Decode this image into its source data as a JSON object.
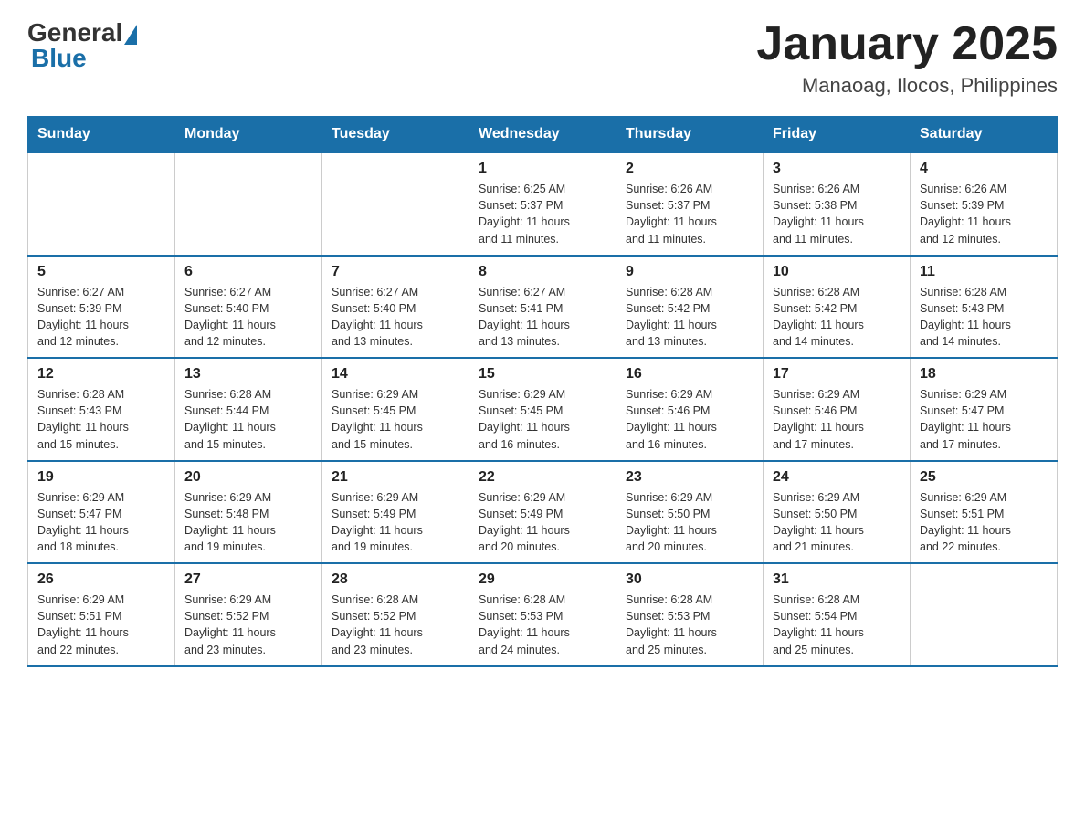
{
  "header": {
    "logo_general": "General",
    "logo_blue": "Blue",
    "title": "January 2025",
    "subtitle": "Manaoag, Ilocos, Philippines"
  },
  "days_of_week": [
    "Sunday",
    "Monday",
    "Tuesday",
    "Wednesday",
    "Thursday",
    "Friday",
    "Saturday"
  ],
  "weeks": [
    [
      {
        "day": "",
        "info": ""
      },
      {
        "day": "",
        "info": ""
      },
      {
        "day": "",
        "info": ""
      },
      {
        "day": "1",
        "info": "Sunrise: 6:25 AM\nSunset: 5:37 PM\nDaylight: 11 hours\nand 11 minutes."
      },
      {
        "day": "2",
        "info": "Sunrise: 6:26 AM\nSunset: 5:37 PM\nDaylight: 11 hours\nand 11 minutes."
      },
      {
        "day": "3",
        "info": "Sunrise: 6:26 AM\nSunset: 5:38 PM\nDaylight: 11 hours\nand 11 minutes."
      },
      {
        "day": "4",
        "info": "Sunrise: 6:26 AM\nSunset: 5:39 PM\nDaylight: 11 hours\nand 12 minutes."
      }
    ],
    [
      {
        "day": "5",
        "info": "Sunrise: 6:27 AM\nSunset: 5:39 PM\nDaylight: 11 hours\nand 12 minutes."
      },
      {
        "day": "6",
        "info": "Sunrise: 6:27 AM\nSunset: 5:40 PM\nDaylight: 11 hours\nand 12 minutes."
      },
      {
        "day": "7",
        "info": "Sunrise: 6:27 AM\nSunset: 5:40 PM\nDaylight: 11 hours\nand 13 minutes."
      },
      {
        "day": "8",
        "info": "Sunrise: 6:27 AM\nSunset: 5:41 PM\nDaylight: 11 hours\nand 13 minutes."
      },
      {
        "day": "9",
        "info": "Sunrise: 6:28 AM\nSunset: 5:42 PM\nDaylight: 11 hours\nand 13 minutes."
      },
      {
        "day": "10",
        "info": "Sunrise: 6:28 AM\nSunset: 5:42 PM\nDaylight: 11 hours\nand 14 minutes."
      },
      {
        "day": "11",
        "info": "Sunrise: 6:28 AM\nSunset: 5:43 PM\nDaylight: 11 hours\nand 14 minutes."
      }
    ],
    [
      {
        "day": "12",
        "info": "Sunrise: 6:28 AM\nSunset: 5:43 PM\nDaylight: 11 hours\nand 15 minutes."
      },
      {
        "day": "13",
        "info": "Sunrise: 6:28 AM\nSunset: 5:44 PM\nDaylight: 11 hours\nand 15 minutes."
      },
      {
        "day": "14",
        "info": "Sunrise: 6:29 AM\nSunset: 5:45 PM\nDaylight: 11 hours\nand 15 minutes."
      },
      {
        "day": "15",
        "info": "Sunrise: 6:29 AM\nSunset: 5:45 PM\nDaylight: 11 hours\nand 16 minutes."
      },
      {
        "day": "16",
        "info": "Sunrise: 6:29 AM\nSunset: 5:46 PM\nDaylight: 11 hours\nand 16 minutes."
      },
      {
        "day": "17",
        "info": "Sunrise: 6:29 AM\nSunset: 5:46 PM\nDaylight: 11 hours\nand 17 minutes."
      },
      {
        "day": "18",
        "info": "Sunrise: 6:29 AM\nSunset: 5:47 PM\nDaylight: 11 hours\nand 17 minutes."
      }
    ],
    [
      {
        "day": "19",
        "info": "Sunrise: 6:29 AM\nSunset: 5:47 PM\nDaylight: 11 hours\nand 18 minutes."
      },
      {
        "day": "20",
        "info": "Sunrise: 6:29 AM\nSunset: 5:48 PM\nDaylight: 11 hours\nand 19 minutes."
      },
      {
        "day": "21",
        "info": "Sunrise: 6:29 AM\nSunset: 5:49 PM\nDaylight: 11 hours\nand 19 minutes."
      },
      {
        "day": "22",
        "info": "Sunrise: 6:29 AM\nSunset: 5:49 PM\nDaylight: 11 hours\nand 20 minutes."
      },
      {
        "day": "23",
        "info": "Sunrise: 6:29 AM\nSunset: 5:50 PM\nDaylight: 11 hours\nand 20 minutes."
      },
      {
        "day": "24",
        "info": "Sunrise: 6:29 AM\nSunset: 5:50 PM\nDaylight: 11 hours\nand 21 minutes."
      },
      {
        "day": "25",
        "info": "Sunrise: 6:29 AM\nSunset: 5:51 PM\nDaylight: 11 hours\nand 22 minutes."
      }
    ],
    [
      {
        "day": "26",
        "info": "Sunrise: 6:29 AM\nSunset: 5:51 PM\nDaylight: 11 hours\nand 22 minutes."
      },
      {
        "day": "27",
        "info": "Sunrise: 6:29 AM\nSunset: 5:52 PM\nDaylight: 11 hours\nand 23 minutes."
      },
      {
        "day": "28",
        "info": "Sunrise: 6:28 AM\nSunset: 5:52 PM\nDaylight: 11 hours\nand 23 minutes."
      },
      {
        "day": "29",
        "info": "Sunrise: 6:28 AM\nSunset: 5:53 PM\nDaylight: 11 hours\nand 24 minutes."
      },
      {
        "day": "30",
        "info": "Sunrise: 6:28 AM\nSunset: 5:53 PM\nDaylight: 11 hours\nand 25 minutes."
      },
      {
        "day": "31",
        "info": "Sunrise: 6:28 AM\nSunset: 5:54 PM\nDaylight: 11 hours\nand 25 minutes."
      },
      {
        "day": "",
        "info": ""
      }
    ]
  ]
}
